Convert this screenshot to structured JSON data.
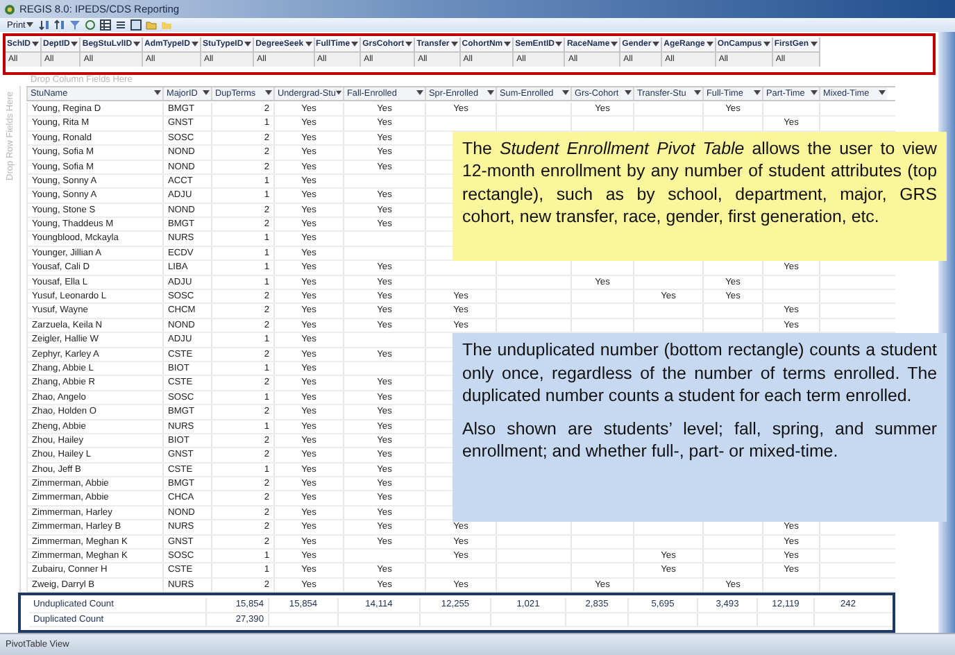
{
  "window": {
    "title": "REGIS 8.0: IPEDS/CDS Reporting"
  },
  "toolbar": {
    "print_label": "Print"
  },
  "filters": [
    {
      "field": "SchID",
      "value": "All"
    },
    {
      "field": "DeptID",
      "value": "All"
    },
    {
      "field": "BegStuLvlID",
      "value": "All"
    },
    {
      "field": "AdmTypeID",
      "value": "All"
    },
    {
      "field": "StuTypeID",
      "value": "All"
    },
    {
      "field": "DegreeSeek",
      "value": "All"
    },
    {
      "field": "FullTime",
      "value": "All"
    },
    {
      "field": "GrsCohort",
      "value": "All"
    },
    {
      "field": "Transfer",
      "value": "All"
    },
    {
      "field": "CohortNm",
      "value": "All"
    },
    {
      "field": "SemEntID",
      "value": "All"
    },
    {
      "field": "RaceName",
      "value": "All"
    },
    {
      "field": "Gender",
      "value": "All"
    },
    {
      "field": "AgeRange",
      "value": "All"
    },
    {
      "field": "OnCampus",
      "value": "All"
    },
    {
      "field": "FirstGen",
      "value": "All"
    }
  ],
  "drop_column_hint": "Drop Column Fields Here",
  "drop_row_hint": "Drop Row Fields Here",
  "table": {
    "columns": [
      "StuName",
      "MajorID",
      "DupTerms",
      "Undergrad-Stu",
      "Fall-Enrolled",
      "Spr-Enrolled",
      "Sum-Enrolled",
      "Grs-Cohort",
      "Transfer-Stu",
      "Full-Time",
      "Part-Time",
      "Mixed-Time"
    ],
    "rows": [
      [
        "Young, Regina D",
        "BMGT",
        "2",
        "Yes",
        "Yes",
        "Yes",
        null,
        "Yes",
        null,
        "Yes",
        null,
        null
      ],
      [
        "Young, Rita M",
        "GNST",
        "1",
        "Yes",
        "Yes",
        null,
        null,
        null,
        null,
        null,
        "Yes",
        null
      ],
      [
        "Young, Ronald",
        "SOSC",
        "2",
        "Yes",
        "Yes"
      ],
      [
        "Young, Sofia M",
        "NOND",
        "2",
        "Yes",
        "Yes"
      ],
      [
        "Young, Sofia M",
        "NOND",
        "2",
        "Yes",
        "Yes"
      ],
      [
        "Young, Sonny A",
        "ACCT",
        "1",
        "Yes",
        null
      ],
      [
        "Young, Sonny A",
        "ADJU",
        "1",
        "Yes",
        "Yes"
      ],
      [
        "Young, Stone S",
        "NOND",
        "2",
        "Yes",
        "Yes"
      ],
      [
        "Young, Thaddeus M",
        "BMGT",
        "2",
        "Yes",
        "Yes"
      ],
      [
        "Youngblood, Mckayla",
        "NURS",
        "1",
        "Yes",
        null
      ],
      [
        "Younger, Jillian A",
        "ECDV",
        "1",
        "Yes",
        null
      ],
      [
        "Yousaf, Cali D",
        "LIBA",
        "1",
        "Yes",
        "Yes",
        null,
        null,
        null,
        null,
        null,
        "Yes",
        null
      ],
      [
        "Yousaf, Ella L",
        "ADJU",
        "1",
        "Yes",
        "Yes",
        null,
        null,
        "Yes",
        null,
        "Yes",
        null,
        null
      ],
      [
        "Yusuf, Leonardo L",
        "SOSC",
        "2",
        "Yes",
        "Yes",
        "Yes",
        null,
        null,
        "Yes",
        "Yes",
        null,
        null
      ],
      [
        "Yusuf, Wayne",
        "CHCM",
        "2",
        "Yes",
        "Yes",
        "Yes",
        null,
        null,
        null,
        null,
        "Yes",
        null
      ],
      [
        "Zarzuela, Keila N",
        "NOND",
        "2",
        "Yes",
        "Yes",
        "Yes",
        null,
        null,
        null,
        null,
        "Yes",
        null
      ],
      [
        "Zeigler, Hallie W",
        "ADJU",
        "1",
        "Yes",
        null
      ],
      [
        "Zephyr, Karley A",
        "CSTE",
        "2",
        "Yes",
        "Yes"
      ],
      [
        "Zhang, Abbie L",
        "BIOT",
        "1",
        "Yes",
        null
      ],
      [
        "Zhang, Abbie R",
        "CSTE",
        "2",
        "Yes",
        "Yes"
      ],
      [
        "Zhao, Angelo",
        "SOSC",
        "1",
        "Yes",
        "Yes"
      ],
      [
        "Zhao, Holden O",
        "BMGT",
        "2",
        "Yes",
        "Yes"
      ],
      [
        "Zheng, Abbie",
        "NURS",
        "1",
        "Yes",
        "Yes"
      ],
      [
        "Zhou, Hailey",
        "BIOT",
        "2",
        "Yes",
        "Yes"
      ],
      [
        "Zhou, Hailey L",
        "GNST",
        "2",
        "Yes",
        "Yes"
      ],
      [
        "Zhou, Jeff B",
        "CSTE",
        "1",
        "Yes",
        "Yes"
      ],
      [
        "Zimmerman, Abbie",
        "BMGT",
        "2",
        "Yes",
        "Yes"
      ],
      [
        "Zimmerman, Abbie",
        "CHCA",
        "2",
        "Yes",
        "Yes"
      ],
      [
        "Zimmerman, Harley",
        "NOND",
        "2",
        "Yes",
        "Yes"
      ],
      [
        "Zimmerman, Harley B",
        "NURS",
        "2",
        "Yes",
        "Yes",
        "Yes",
        null,
        null,
        null,
        null,
        "Yes",
        null
      ],
      [
        "Zimmerman, Meghan K",
        "GNST",
        "2",
        "Yes",
        "Yes",
        "Yes",
        null,
        null,
        null,
        null,
        "Yes",
        null
      ],
      [
        "Zimmerman, Meghan K",
        "SOSC",
        "1",
        "Yes",
        null,
        "Yes",
        null,
        null,
        "Yes",
        null,
        "Yes",
        null
      ],
      [
        "Zubairu, Conner H",
        "CSTE",
        "1",
        "Yes",
        "Yes",
        null,
        null,
        null,
        "Yes",
        null,
        "Yes",
        null
      ],
      [
        "Zweig, Darryl B",
        "NURS",
        "2",
        "Yes",
        "Yes",
        "Yes",
        null,
        "Yes",
        null,
        "Yes",
        null,
        null
      ]
    ],
    "totals": [
      {
        "label": "Unduplicated Count",
        "values": [
          "15,854",
          "15,854",
          "14,114",
          "12,255",
          "1,021",
          "2,835",
          "5,695",
          "3,493",
          "12,119",
          "242"
        ]
      },
      {
        "label": "Duplicated Count",
        "values": [
          "27,390"
        ]
      }
    ]
  },
  "notes": [
    {
      "color": "#fbf59b",
      "paragraphs": [
        "The *Student Enrollment Pivot Table* allows the user to view 12-month enrollment by any number of student attributes (top rectangle), such as by school, department, major, GRS cohort, new transfer, race, gender, first generation, etc."
      ]
    },
    {
      "color": "#c6d9f0",
      "paragraphs": [
        "The unduplicated number (bottom rectangle) counts a student only once, regardless of the number of terms enrolled.  The duplicated number counts a student for each term enrolled.",
        "Also shown are students’ level; fall, spring, and summer enrollment;  and whether full-, part- or mixed-time."
      ]
    }
  ],
  "status_bar": "PivotTable View"
}
